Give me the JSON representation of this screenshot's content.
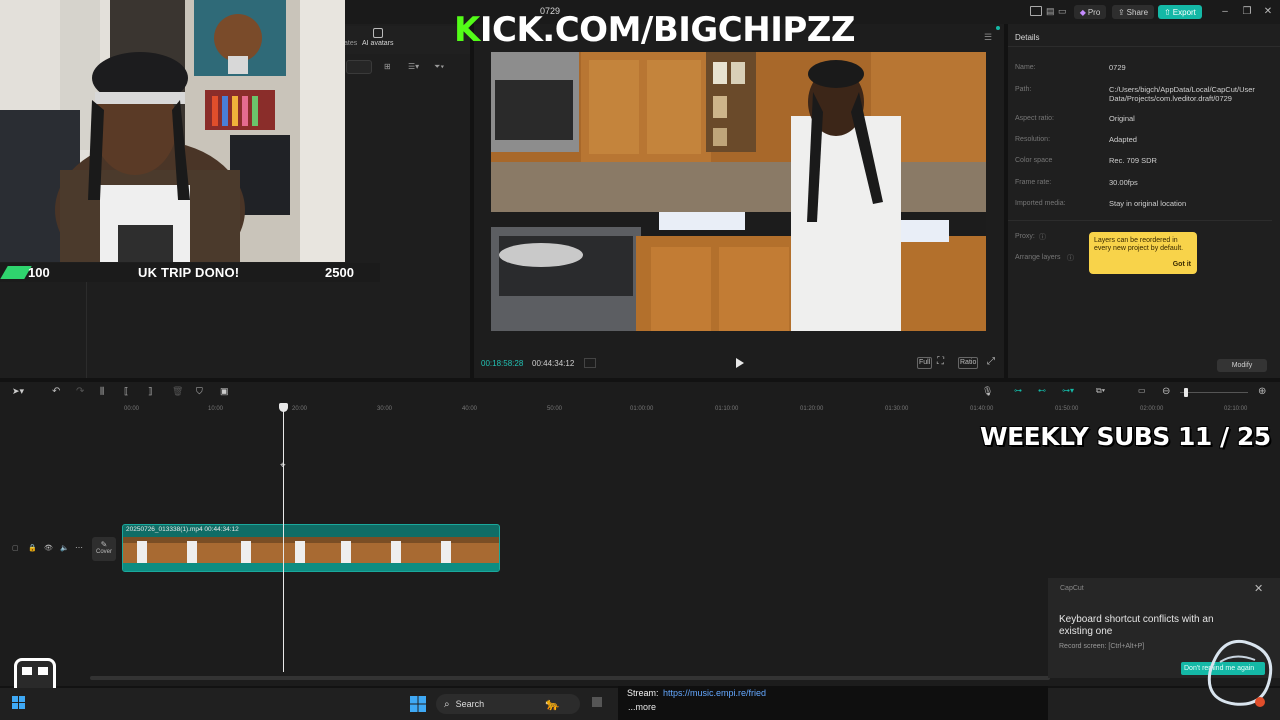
{
  "app": {
    "title": "0729",
    "pro_label": "Pro",
    "share_label": "Share",
    "export_label": "Export",
    "accent": "#14b8a6"
  },
  "media_panel": {
    "tabs": [
      "ates",
      "AI avatars"
    ]
  },
  "overlay": {
    "kick_k": "K",
    "kick_rest": "ICK.COM/BIGCHIPZZ",
    "dono_current": "100",
    "dono_title": "UK TRIP DONO!",
    "dono_goal": "2500",
    "weekly_subs": "WEEKLY SUBS  11 / 25",
    "kick_green": "#53fc18"
  },
  "player": {
    "time_current": "00:18:58:28",
    "time_total": "00:44:34:12",
    "full_label": "Full",
    "ratio_label": "Ratio"
  },
  "details": {
    "title": "Details",
    "rows": [
      {
        "label": "Name:",
        "value": "0729"
      },
      {
        "label": "Path:",
        "value": "C:/Users/bigch/AppData/Local/CapCut/User Data/Projects/com.lveditor.draft/0729"
      },
      {
        "label": "Aspect ratio:",
        "value": "Original"
      },
      {
        "label": "Resolution:",
        "value": "Adapted"
      },
      {
        "label": "Color space",
        "value": "Rec. 709 SDR"
      },
      {
        "label": "Frame rate:",
        "value": "30.00fps"
      },
      {
        "label": "Imported media:",
        "value": "Stay in original location"
      }
    ],
    "proxy_label": "Proxy:",
    "arrange_label": "Arrange layers",
    "tooltip_text": "Layers can be reordered in every new project by default.",
    "tooltip_button": "Got it",
    "modify_label": "Modify"
  },
  "timeline": {
    "ticks": [
      "00:00",
      "10:00",
      "20:00",
      "30:00",
      "40:00",
      "50:00",
      "01:00:00",
      "01:10:00",
      "01:20:00",
      "01:30:00",
      "01:40:00",
      "01:50:00",
      "02:00:00",
      "02:10:00"
    ],
    "clip_label": "20250726_013338(1).mp4   00:44:34:12",
    "cover_label": "Cover"
  },
  "notification": {
    "app": "CapCut",
    "message": "Keyboard shortcut conflicts with an existing one",
    "sub": "Record screen: [Ctrl+Alt+P]",
    "button": "Don't remind me again"
  },
  "taskbar": {
    "search_label": "Search",
    "stream_label": "Stream:",
    "stream_link": "https://music.empi.re/fried",
    "more_label": "...more"
  }
}
